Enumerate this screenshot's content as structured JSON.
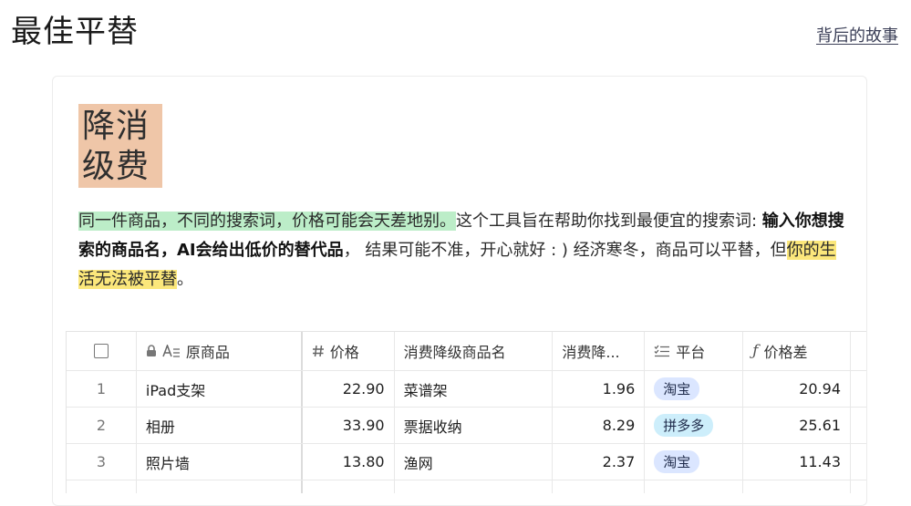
{
  "header": {
    "title": "最佳平替",
    "story_link": "背后的故事"
  },
  "brand": {
    "line1": "降消",
    "line2": "级费"
  },
  "description": {
    "highlight_green": "同一件商品，不同的搜索词，价格可能会天差地别。",
    "text1": "这个工具旨在帮助你找到最便宜的搜索词: ",
    "bold": "输入你想搜索的商品名，AI会给出低价的替代品",
    "text2": "， 结果可能不准，开心就好 : ) 经济寒冬，商品可以平替，但",
    "highlight_yellow": "你的生活无法被平替",
    "text3": "。"
  },
  "table": {
    "columns": [
      "原商品",
      "价格",
      "消费降级商品名",
      "消费降...",
      "平台",
      "价格差"
    ],
    "rows": [
      {
        "index": "1",
        "original": "iPad支架",
        "price": "22.90",
        "alt": "菜谱架",
        "alt_price": "1.96",
        "platform": "淘宝",
        "diff": "20.94"
      },
      {
        "index": "2",
        "original": "相册",
        "price": "33.90",
        "alt": "票据收纳",
        "alt_price": "8.29",
        "platform": "拼多多",
        "diff": "25.61"
      },
      {
        "index": "3",
        "original": "照片墙",
        "price": "13.80",
        "alt": "渔网",
        "alt_price": "2.37",
        "platform": "淘宝",
        "diff": "11.43"
      }
    ]
  },
  "colors": {
    "brand_bg": "#efc6a8",
    "highlight_green": "#bcedc8",
    "highlight_yellow": "#fbe77b",
    "tag_taobao": "#dbe6ff",
    "tag_pdd": "#cdeefb"
  },
  "icons": {
    "lock": "lock-icon",
    "text_field": "text-field-icon",
    "number": "hash-icon",
    "select": "list-icon",
    "formula": "formula-icon"
  }
}
